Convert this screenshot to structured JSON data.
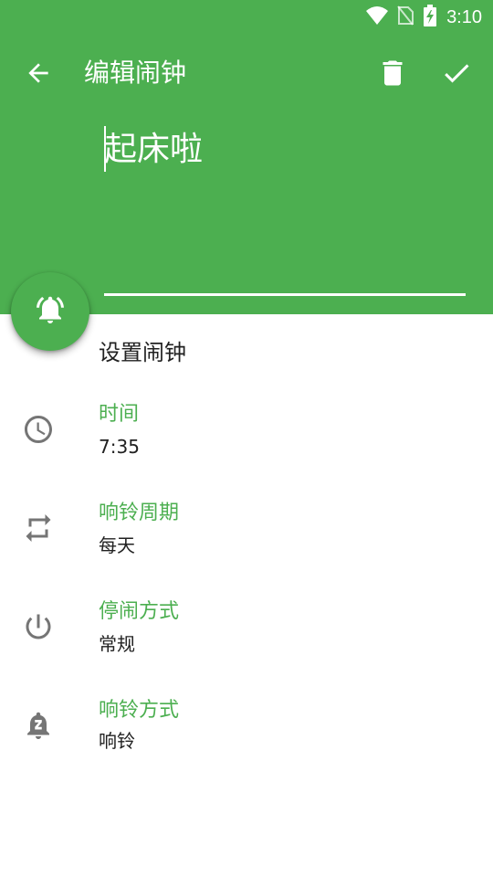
{
  "status_bar": {
    "time": "3:10",
    "icons": [
      "wifi-icon",
      "no-sim-icon",
      "battery-charging-icon"
    ]
  },
  "toolbar": {
    "title": "编辑闹钟",
    "icons": [
      "back-arrow-icon",
      "delete-icon",
      "check-icon"
    ]
  },
  "alarm_name": {
    "value": "起床啦"
  },
  "section": {
    "title": "设置闹钟"
  },
  "settings": [
    {
      "label": "时间",
      "value": "7:35",
      "icon": "clock-icon"
    },
    {
      "label": "响铃周期",
      "value": "每天",
      "icon": "repeat-icon"
    },
    {
      "label": "停闹方式",
      "value": "常规",
      "icon": "power-icon"
    },
    {
      "label": "响铃方式",
      "value": "响铃",
      "icon": "bell-snooze-icon"
    }
  ],
  "colors": {
    "primary": "#4CAF50",
    "text": "#212121",
    "icon_gray": "#757575"
  }
}
